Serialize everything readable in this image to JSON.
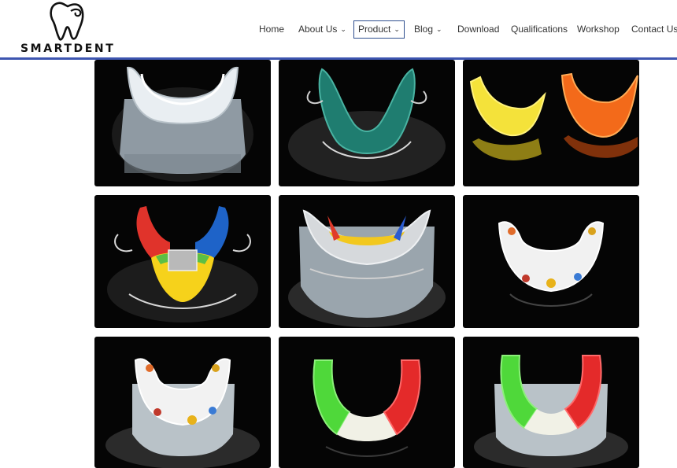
{
  "brand": {
    "logo_text": "SMARTDENT"
  },
  "nav": {
    "items": [
      {
        "label": "Home"
      },
      {
        "label": "About Us"
      },
      {
        "label": "Product"
      },
      {
        "label": "Blog"
      },
      {
        "label": "Download"
      },
      {
        "label": "Qualifications"
      },
      {
        "label": "Workshop"
      },
      {
        "label": "Contact Us"
      }
    ],
    "active": "Product"
  },
  "colors": {
    "nav_rule": "#3d55b0",
    "active_border": "#2f4f8f",
    "tile_bg": "#050505"
  },
  "gallery": {
    "tiles": [
      {
        "subject": "clear-night-guard-on-model"
      },
      {
        "subject": "green-retainer-with-wires"
      },
      {
        "subject": "yellow-and-orange-aligners"
      },
      {
        "subject": "rainbow-expander-appliance"
      },
      {
        "subject": "yellow-retainer-on-model"
      },
      {
        "subject": "white-cartoon-mouthguard"
      },
      {
        "subject": "white-cartoon-mouthguard-on-model"
      },
      {
        "subject": "green-white-red-mouthguard"
      },
      {
        "subject": "green-white-red-mouthguard-on-model"
      }
    ]
  }
}
